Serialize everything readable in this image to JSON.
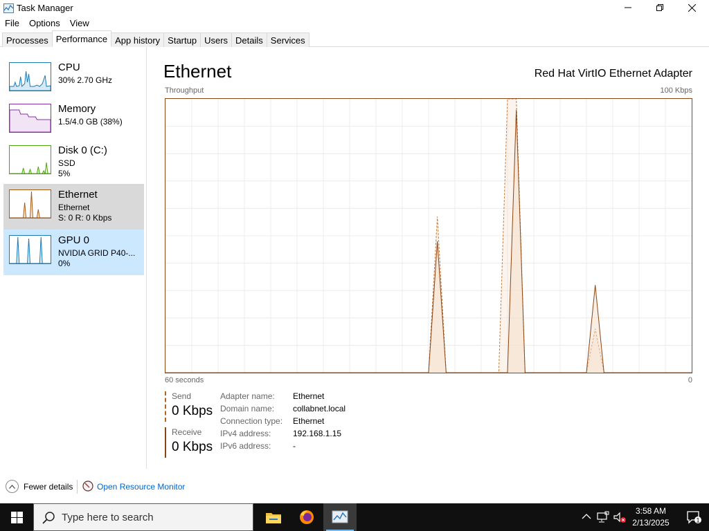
{
  "window": {
    "title": "Task Manager",
    "menu": [
      "File",
      "Options",
      "View"
    ],
    "tabs": [
      "Processes",
      "Performance",
      "App history",
      "Startup",
      "Users",
      "Details",
      "Services"
    ],
    "active_tab": "Performance"
  },
  "sidebar": {
    "items": [
      {
        "title": "CPU",
        "sub1": "30%  2.70 GHz",
        "sub2": "",
        "color": "#1a7ab5"
      },
      {
        "title": "Memory",
        "sub1": "1.5/4.0 GB (38%)",
        "sub2": "",
        "color": "#8b2fa8"
      },
      {
        "title": "Disk 0 (C:)",
        "sub1": "SSD",
        "sub2": "5%",
        "color": "#4da60c"
      },
      {
        "title": "Ethernet",
        "sub1": "Ethernet",
        "sub2": "S: 0  R: 0 Kbps",
        "color": "#a75b14"
      },
      {
        "title": "GPU 0",
        "sub1": "NVIDIA GRID P40-...",
        "sub2": "0%",
        "color": "#1a7ab5"
      }
    ],
    "selected": "Ethernet"
  },
  "main": {
    "heading": "Ethernet",
    "adapter": "Red Hat VirtIO Ethernet Adapter",
    "graph_label": "Throughput",
    "graph_max": "100 Kbps",
    "time_span": "60 seconds",
    "graph_min": "0",
    "send_label": "Send",
    "send_value": "0 Kbps",
    "receive_label": "Receive",
    "receive_value": "0 Kbps",
    "details": [
      {
        "key": "Adapter name:",
        "value": "Ethernet"
      },
      {
        "key": "Domain name:",
        "value": "collabnet.local"
      },
      {
        "key": "Connection type:",
        "value": "Ethernet"
      },
      {
        "key": "IPv4 address:",
        "value": "192.168.1.15"
      },
      {
        "key": "IPv6 address:",
        "value": "-"
      }
    ]
  },
  "chart_data": {
    "type": "area",
    "ylim": [
      0,
      100
    ],
    "x": [
      0,
      28,
      29,
      30,
      31,
      32,
      33,
      34,
      35,
      36,
      37,
      38,
      39,
      40,
      41,
      42,
      43,
      44,
      45,
      46,
      47,
      48,
      49,
      50,
      51,
      52,
      53,
      54,
      55,
      56,
      57,
      58,
      59,
      60
    ],
    "series": [
      {
        "name": "Send",
        "style": "dashed",
        "values": [
          0,
          0,
          0,
          0,
          57,
          0,
          0,
          0,
          0,
          0,
          0,
          0,
          100,
          100,
          0,
          0,
          0,
          0,
          0,
          0,
          0,
          0,
          16,
          0,
          0,
          0,
          0,
          0,
          0,
          0,
          0,
          0,
          0,
          0
        ]
      },
      {
        "name": "Receive",
        "style": "solid",
        "values": [
          0,
          0,
          0,
          0,
          48,
          0,
          0,
          0,
          0,
          0,
          0,
          0,
          0,
          96,
          0,
          0,
          0,
          0,
          0,
          0,
          0,
          0,
          32,
          0,
          0,
          0,
          0,
          0,
          0,
          0,
          0,
          0,
          0,
          0
        ]
      }
    ]
  },
  "footer": {
    "fewer_details": "Fewer details",
    "open_resource_monitor": "Open Resource Monitor"
  },
  "taskbar": {
    "search_placeholder": "Type here to search",
    "time": "3:58 AM",
    "date": "2/13/2025",
    "notification_count": "1",
    "colors": {
      "background": "#101010",
      "accent": "#76b9ed"
    }
  }
}
